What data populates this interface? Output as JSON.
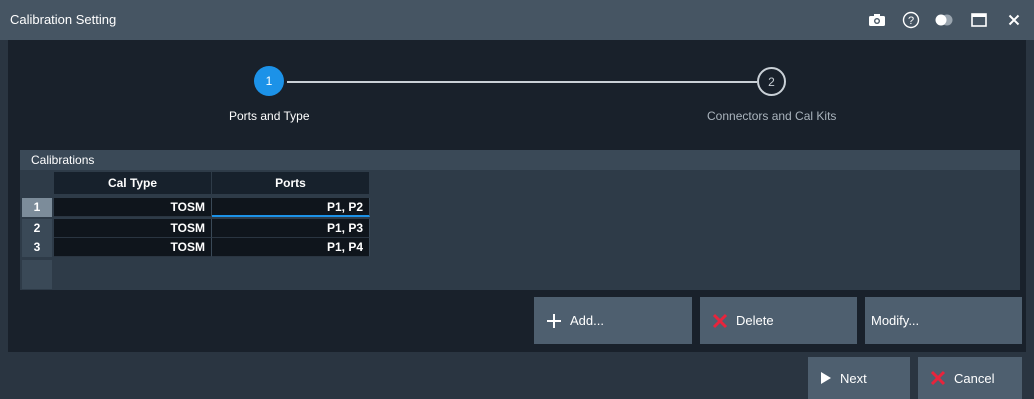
{
  "window": {
    "title": "Calibration Setting",
    "icons": [
      "camera-icon",
      "help-icon",
      "toggle-icon",
      "maximize-icon",
      "close-icon"
    ]
  },
  "stepper": {
    "steps": [
      {
        "number": "1",
        "label": "Ports and Type",
        "state": "active"
      },
      {
        "number": "2",
        "label": "Connectors and Cal Kits",
        "state": "inactive"
      }
    ]
  },
  "calibrations": {
    "title": "Calibrations",
    "columns": [
      "Cal Type",
      "Ports"
    ],
    "rows": [
      {
        "index": "1",
        "cal_type": "TOSM",
        "ports": "P1, P2"
      },
      {
        "index": "2",
        "cal_type": "TOSM",
        "ports": "P1, P3"
      },
      {
        "index": "3",
        "cal_type": "TOSM",
        "ports": "P1, P4"
      }
    ],
    "selected_row": 1
  },
  "actions": {
    "add_label": "Add...",
    "delete_label": "Delete",
    "modify_label": "Modify..."
  },
  "footer": {
    "next_label": "Next",
    "cancel_label": "Cancel"
  },
  "colors": {
    "accent": "#1c92e8",
    "delete_red": "#e8243c",
    "titlebar": "#465563",
    "panel": "#19212b"
  }
}
